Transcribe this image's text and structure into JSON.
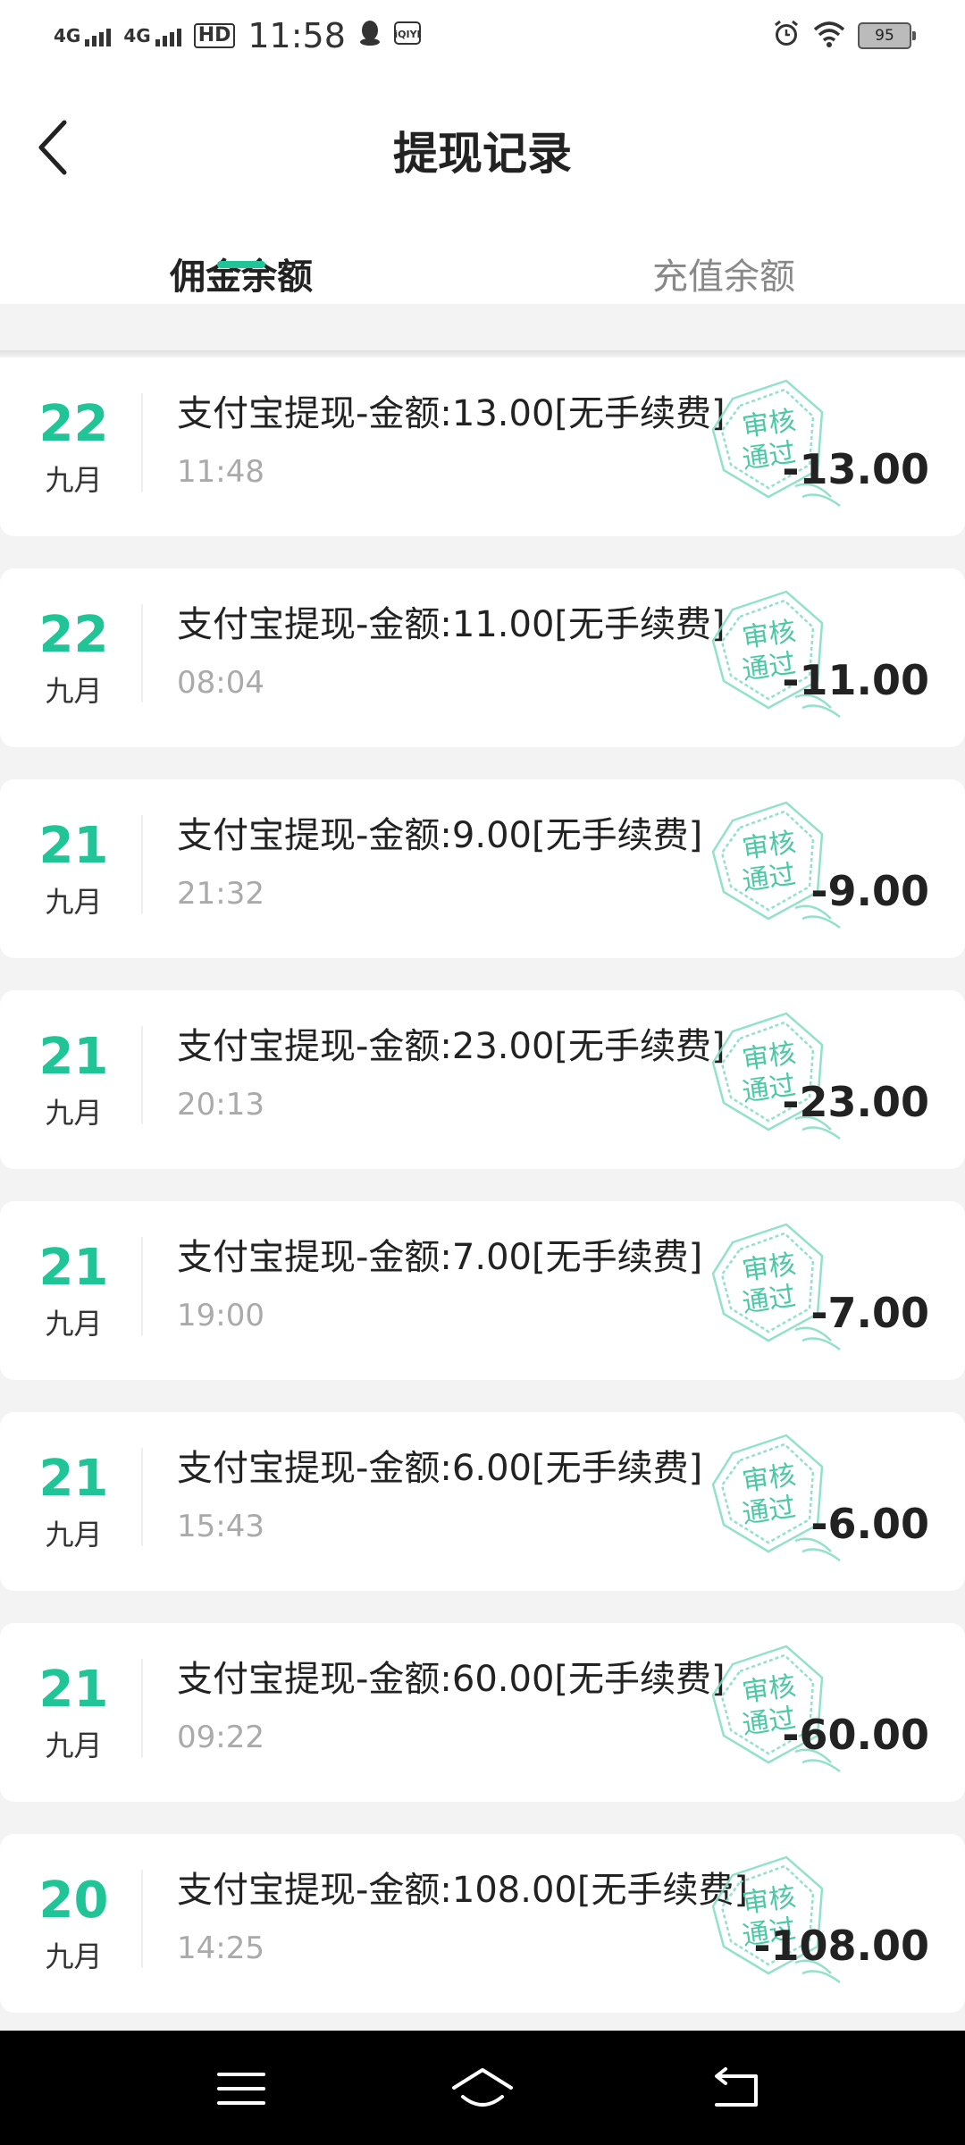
{
  "status_bar": {
    "net1": "4G",
    "net2": "4G",
    "hd": "HD",
    "time": "11:58",
    "battery": "95",
    "icons": [
      "qq-icon",
      "iqiyi-icon",
      "alarm-icon",
      "wifi-icon",
      "battery-icon"
    ]
  },
  "header": {
    "title": "提现记录",
    "back_icon": "chevron-left-icon"
  },
  "tabs": [
    {
      "label": "佣金余额",
      "active": true
    },
    {
      "label": "充值余额",
      "active": false
    }
  ],
  "accent_color": "#21c497",
  "stamp_text": {
    "line1": "审核",
    "line2": "通过"
  },
  "records": [
    {
      "day": "22",
      "month": "九月",
      "title": "支付宝提现-金额:13.00[无手续费]",
      "time": "11:48",
      "amount": "-13.00"
    },
    {
      "day": "22",
      "month": "九月",
      "title": "支付宝提现-金额:11.00[无手续费]",
      "time": "08:04",
      "amount": "-11.00"
    },
    {
      "day": "21",
      "month": "九月",
      "title": "支付宝提现-金额:9.00[无手续费]",
      "time": "21:32",
      "amount": "-9.00"
    },
    {
      "day": "21",
      "month": "九月",
      "title": "支付宝提现-金额:23.00[无手续费]",
      "time": "20:13",
      "amount": "-23.00"
    },
    {
      "day": "21",
      "month": "九月",
      "title": "支付宝提现-金额:7.00[无手续费]",
      "time": "19:00",
      "amount": "-7.00"
    },
    {
      "day": "21",
      "month": "九月",
      "title": "支付宝提现-金额:6.00[无手续费]",
      "time": "15:43",
      "amount": "-6.00"
    },
    {
      "day": "21",
      "month": "九月",
      "title": "支付宝提现-金额:60.00[无手续费]",
      "time": "09:22",
      "amount": "-60.00"
    },
    {
      "day": "20",
      "month": "九月",
      "title": "支付宝提现-金额:108.00[无手续费]",
      "time": "14:25",
      "amount": "-108.00"
    }
  ],
  "nav_bar": {
    "icons": [
      "menu-icon",
      "home-icon",
      "back-icon"
    ]
  }
}
